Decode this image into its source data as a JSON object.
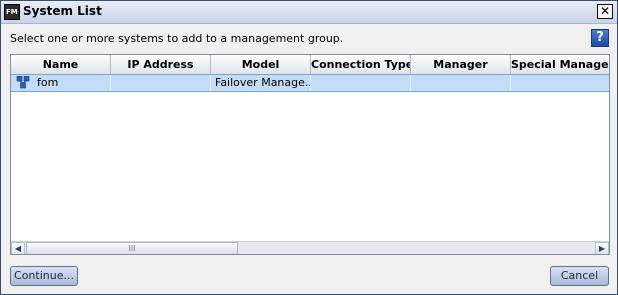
{
  "window": {
    "title": "System List",
    "app_icon_text": "FM"
  },
  "instruction": "Select one or more systems to add to a management group.",
  "help_label": "?",
  "table": {
    "columns": [
      "Name",
      "IP Address",
      "Model",
      "Connection Type",
      "Manager",
      "Special Manager"
    ],
    "rows": [
      {
        "name": "fom",
        "ip_address": "",
        "model": "Failover Manage...",
        "connection_type": "",
        "manager": "",
        "special_manager": ""
      }
    ]
  },
  "scrollbar": {
    "left_arrow": "◀",
    "right_arrow": "▶",
    "thumb_grip": "III"
  },
  "buttons": {
    "continue": "Continue...",
    "cancel": "Cancel"
  }
}
